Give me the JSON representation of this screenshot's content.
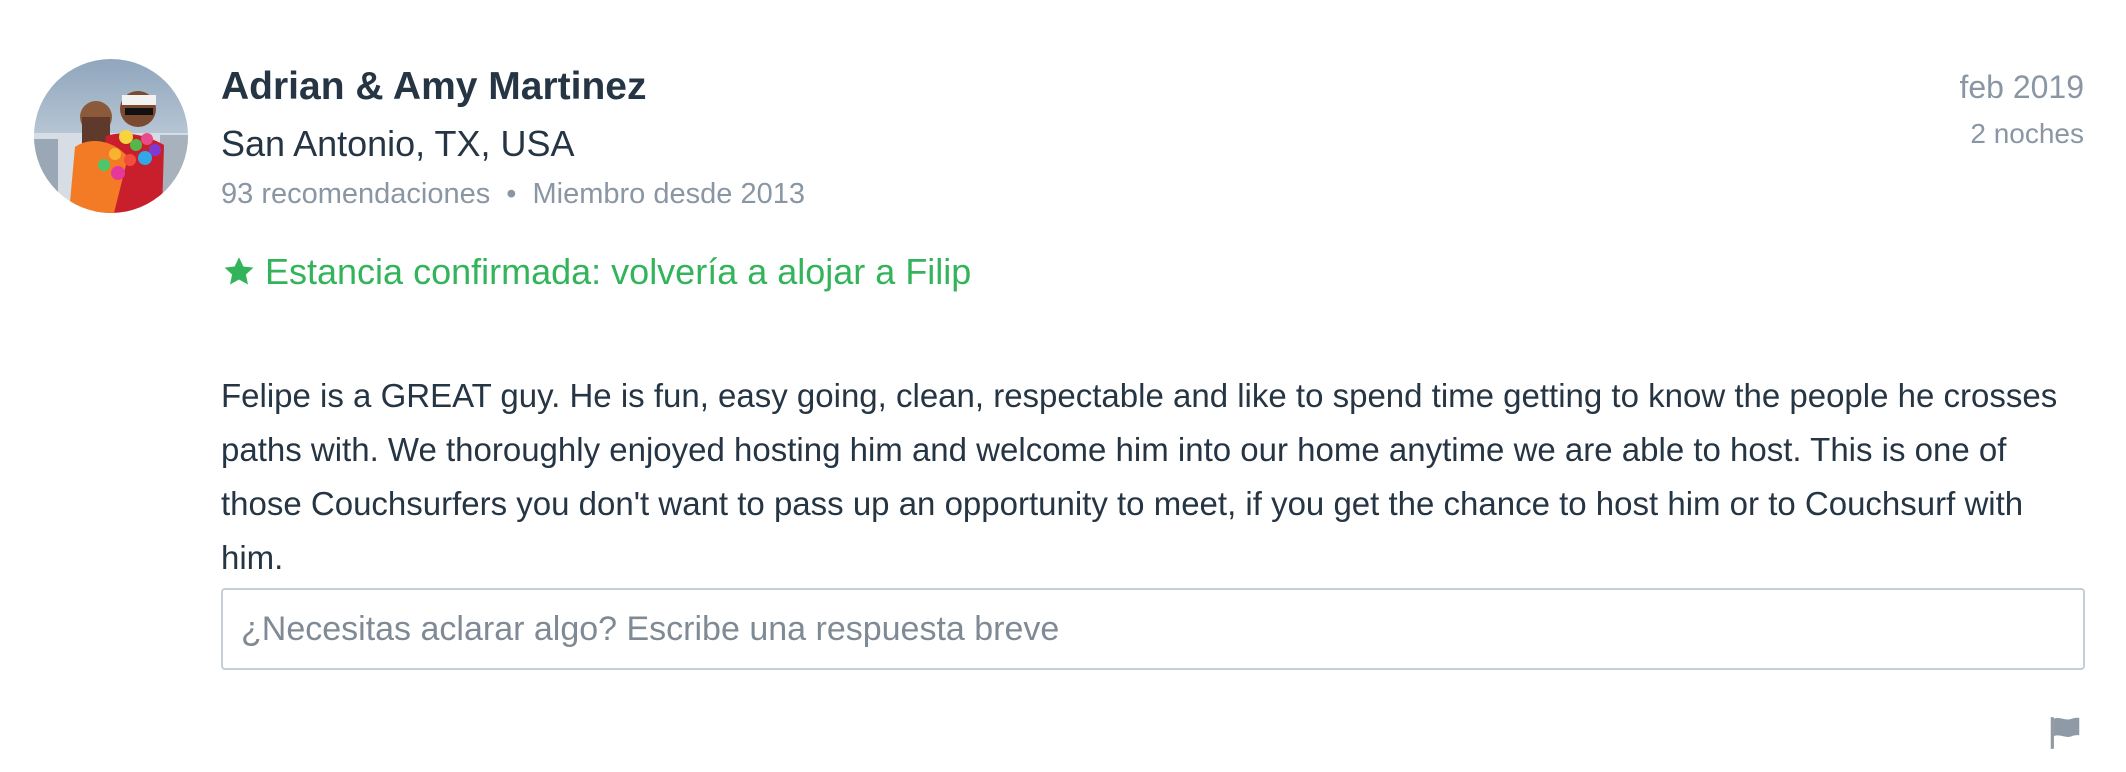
{
  "reviewer": {
    "name": "Adrian & Amy Martinez",
    "location": "San Antonio, TX, USA",
    "recommendations": "93 recomendaciones",
    "separator": "•",
    "member_since": "Miembro desde 2013",
    "avatar_icon": "profile-photo"
  },
  "stay": {
    "date": "feb 2019",
    "nights": "2 noches"
  },
  "confirmation": {
    "icon": "star-icon",
    "text": "Estancia confirmada: volvería a alojar a Filip",
    "color": "#33b35a"
  },
  "review": {
    "text": "Felipe is a GREAT guy. He is fun, easy going, clean, respectable and like to spend time getting to know the people he crosses paths with. We thoroughly enjoyed hosting him and welcome him into our home anytime we are able to host. This is one of those Couchsurfers you don't want to pass up an opportunity to meet, if you get the chance to host him or to Couchsurf with him."
  },
  "reply": {
    "value": "",
    "placeholder": "¿Necesitas aclarar algo? Escribe una respuesta breve"
  },
  "actions": {
    "flag_icon": "flag-icon"
  },
  "colors": {
    "text": "#263544",
    "muted": "#8a96a3",
    "accent": "#33b35a",
    "border": "#c6cdd4"
  }
}
